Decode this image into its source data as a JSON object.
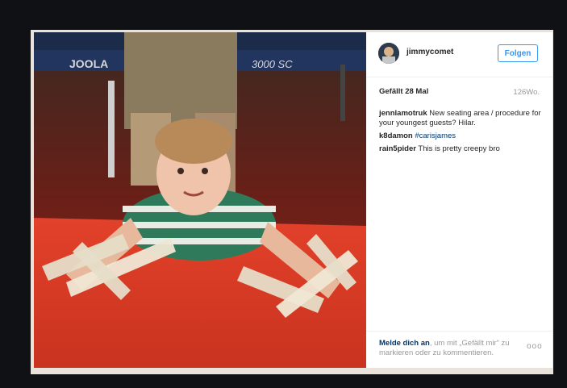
{
  "post": {
    "username": "jimmycomet",
    "follow_label": "Folgen",
    "likes": "Gefällt 28 Mal",
    "age": "126Wo."
  },
  "photo": {
    "banner_brand": "JOOLA",
    "banner_model": "3000 SC"
  },
  "comments": [
    {
      "user": "jennlamotruk",
      "text": "New seating area / procedure for your youngest guests? Hilar."
    },
    {
      "user": "k8damon",
      "text": "",
      "hashtag": "#carisjames"
    },
    {
      "user": "rain5pider",
      "text": "This is pretty creepy bro"
    }
  ],
  "footer": {
    "login_link": "Melde dich an",
    "login_rest": ", um mit „Gefällt mir“ zu markieren oder zu kommentieren.",
    "more_label": "ooo"
  },
  "colors": {
    "accent": "#3897f0",
    "link": "#003569",
    "background": "#0f1114"
  }
}
